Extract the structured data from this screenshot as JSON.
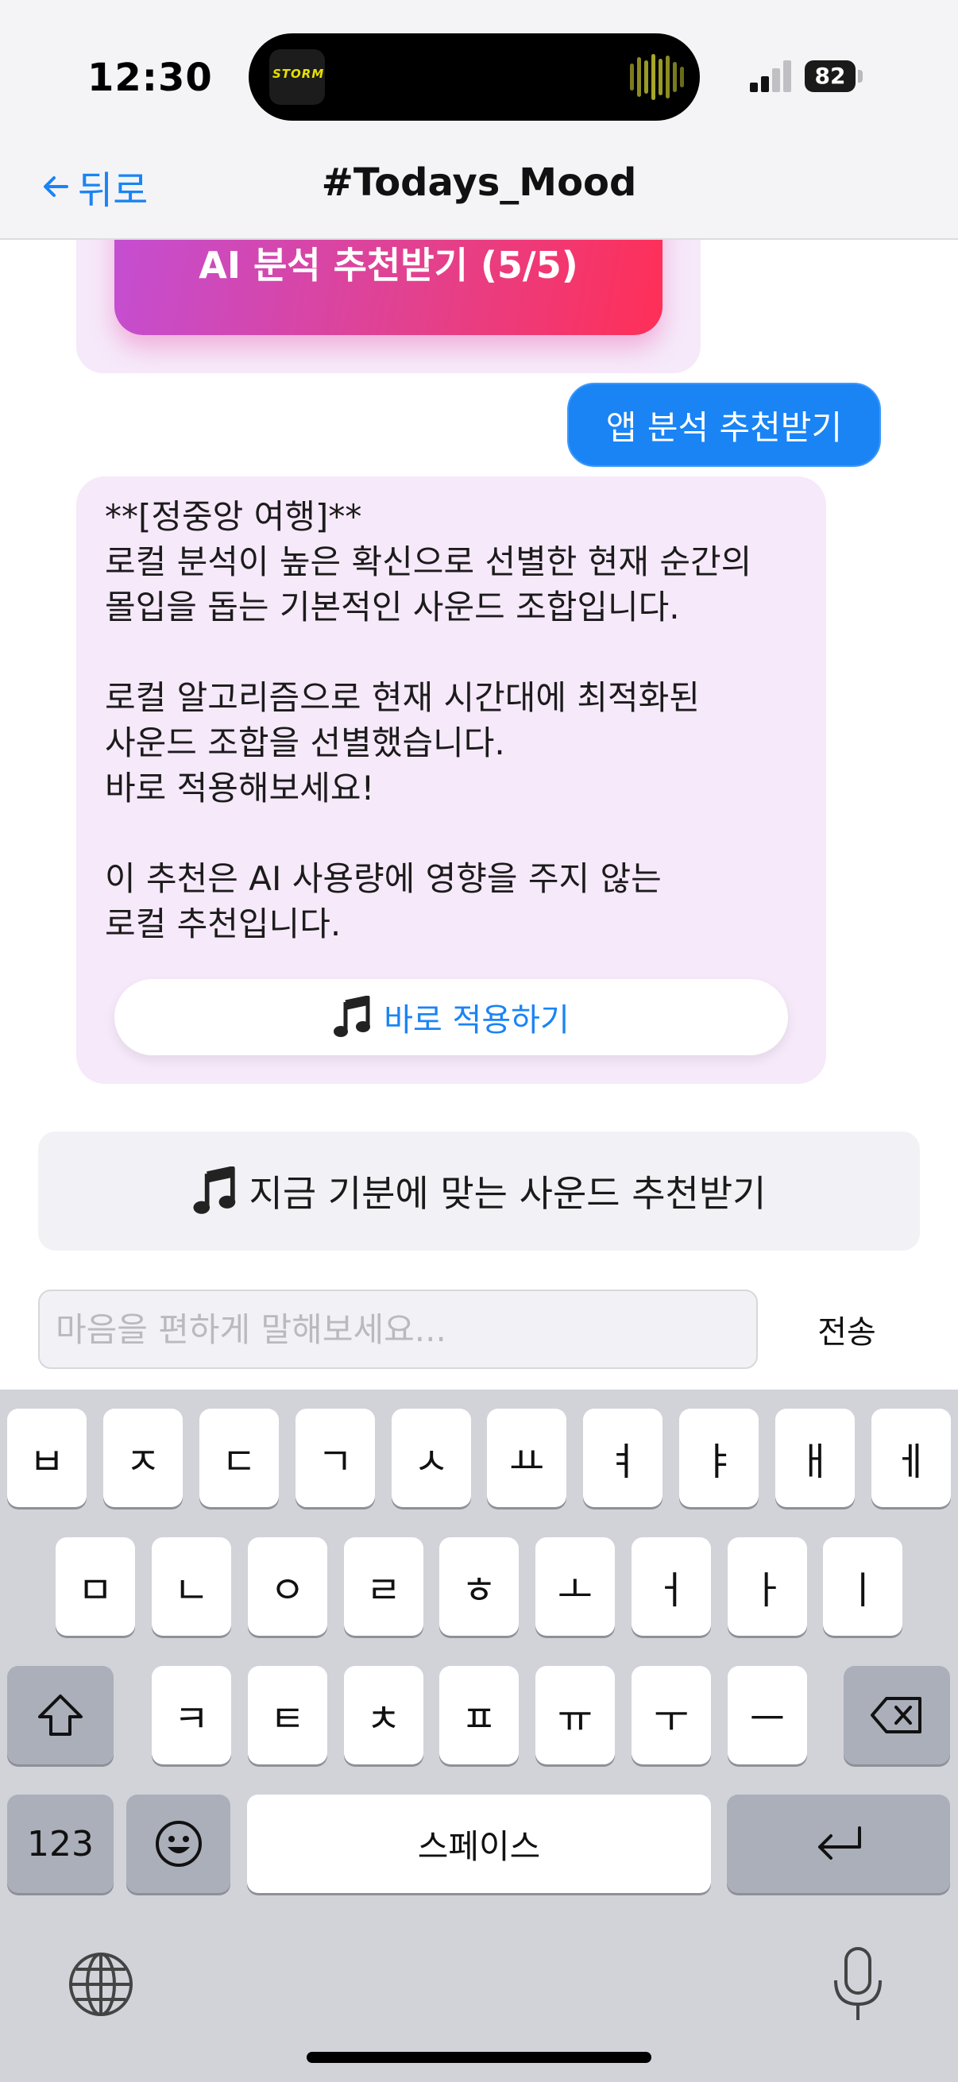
{
  "status": {
    "time": "12:30",
    "battery": "82",
    "island_app": "STORM"
  },
  "nav": {
    "back_label": "뒤로",
    "title": "#Todays_Mood"
  },
  "chat": {
    "ai_button_label": "AI 분석 추천받기 (5/5)",
    "user_message": "앱 분석 추천받기",
    "bot_message": "**[정중앙 여행]**\n로컬 분석이 높은 확신으로 선별한 현재 순간의\n몰입을 돕는 기본적인 사운드 조합입니다.\n\n로컬 알고리즘으로 현재 시간대에 최적화된\n사운드 조합을 선별했습니다.\n바로 적용해보세요!\n\n이 추천은 AI 사용량에 영향을 주지 않는\n로컬 추천입니다.",
    "apply_label": "바로 적용하기",
    "recommend_label": "지금 기분에 맞는 사운드 추천받기"
  },
  "composer": {
    "placeholder": "마음을 편하게 말해보세요...",
    "send_label": "전송"
  },
  "keyboard": {
    "row1": [
      "ㅂ",
      "ㅈ",
      "ㄷ",
      "ㄱ",
      "ㅅ",
      "ㅛ",
      "ㅕ",
      "ㅑ",
      "ㅐ",
      "ㅔ"
    ],
    "row2": [
      "ㅁ",
      "ㄴ",
      "ㅇ",
      "ㄹ",
      "ㅎ",
      "ㅗ",
      "ㅓ",
      "ㅏ",
      "ㅣ"
    ],
    "row3": [
      "ㅋ",
      "ㅌ",
      "ㅊ",
      "ㅍ",
      "ㅠ",
      "ㅜ",
      "ㅡ"
    ],
    "numbers_label": "123",
    "space_label": "스페이스"
  },
  "icons": {
    "accent_color": "#1a84f5",
    "gradient": [
      "#c34ed3",
      "#ff2f57"
    ]
  }
}
